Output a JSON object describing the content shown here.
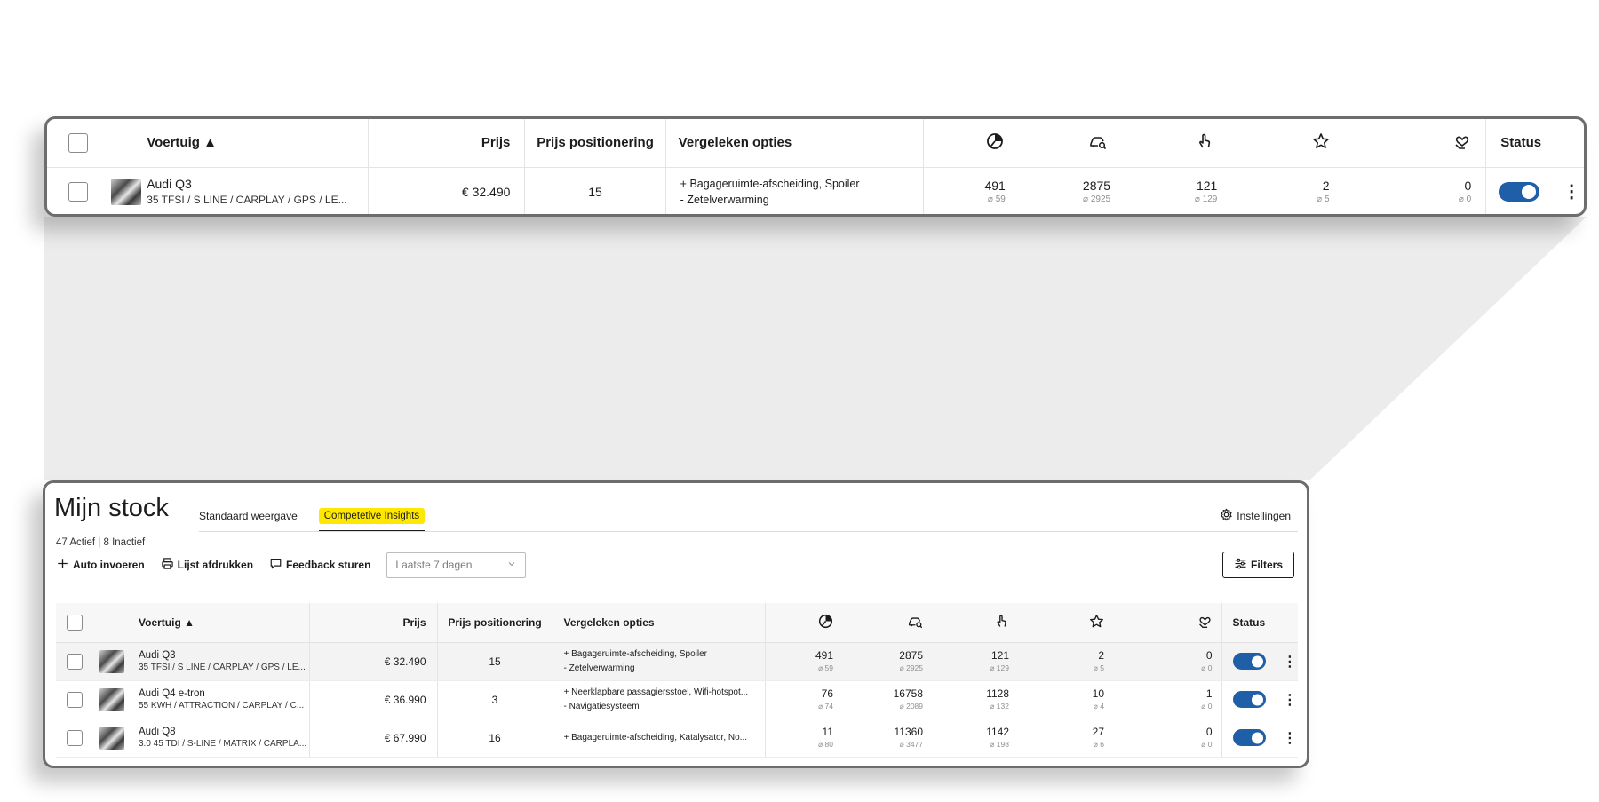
{
  "colors": {
    "accent": "#1f5fa8",
    "highlight": "#ffe800",
    "frame": "#6d6d6d"
  },
  "zoom": {
    "columns": {
      "vehicle": "Voertuig ▲",
      "price": "Prijs",
      "positioning": "Prijs positionering",
      "options": "Vergeleken opties",
      "status": "Status"
    },
    "icons": [
      "pie-chart-icon",
      "car-search-icon",
      "touch-click-icon",
      "star-icon",
      "heart-hand-icon"
    ],
    "row": {
      "name": "Audi Q3",
      "sub": "35 TFSI / S LINE / CARPLAY / GPS / LE...",
      "price": "€ 32.490",
      "positioning": "15",
      "options_plus": "+ Bagageruimte-afscheiding, Spoiler",
      "options_minus": "-  Zetelverwarming",
      "metrics": [
        {
          "value": "491",
          "avg": "⌀ 59"
        },
        {
          "value": "2875",
          "avg": "⌀ 2925"
        },
        {
          "value": "121",
          "avg": "⌀ 129"
        },
        {
          "value": "2",
          "avg": "⌀ 5"
        },
        {
          "value": "0",
          "avg": "⌀ 0"
        }
      ],
      "status_on": true
    }
  },
  "main": {
    "title": "Mijn stock",
    "tabs": {
      "standard": "Standaard weergave",
      "insights": "Competetive Insights"
    },
    "settings": "Instellingen",
    "counts": "47 Actief  |  8 Inactief",
    "toolbar": {
      "add": "Auto invoeren",
      "print": "Lijst afdrukken",
      "feedback": "Feedback sturen",
      "date": "Laatste 7 dagen",
      "filters": "Filters"
    },
    "columns": {
      "vehicle": "Voertuig ▲",
      "price": "Prijs",
      "positioning": "Prijs positionering",
      "options": "Vergeleken opties",
      "status": "Status"
    },
    "rows": [
      {
        "name": "Audi Q3",
        "sub": "35 TFSI / S LINE / CARPLAY / GPS / LE...",
        "price": "€ 32.490",
        "positioning": "15",
        "options_plus": "+ Bagageruimte-afscheiding, Spoiler",
        "options_minus": "-  Zetelverwarming",
        "metrics": [
          {
            "value": "491",
            "avg": "⌀ 59"
          },
          {
            "value": "2875",
            "avg": "⌀ 2925"
          },
          {
            "value": "121",
            "avg": "⌀ 129"
          },
          {
            "value": "2",
            "avg": "⌀ 5"
          },
          {
            "value": "0",
            "avg": "⌀ 0"
          }
        ]
      },
      {
        "name": "Audi Q4 e-tron",
        "sub": "55 KWH / ATTRACTION / CARPLAY / C...",
        "price": "€ 36.990",
        "positioning": "3",
        "options_plus": "+ Neerklapbare passagiersstoel, Wifi-hotspot...",
        "options_minus": "-  Navigatiesysteem",
        "metrics": [
          {
            "value": "76",
            "avg": "⌀ 74"
          },
          {
            "value": "16758",
            "avg": "⌀ 2089"
          },
          {
            "value": "1128",
            "avg": "⌀ 132"
          },
          {
            "value": "10",
            "avg": "⌀ 4"
          },
          {
            "value": "1",
            "avg": "⌀ 0"
          }
        ]
      },
      {
        "name": "Audi Q8",
        "sub": "3.0 45 TDI / S-LINE / MATRIX / CARPLA...",
        "price": "€ 67.990",
        "positioning": "16",
        "options_plus": "+ Bagageruimte-afscheiding, Katalysator, No...",
        "options_minus": "",
        "metrics": [
          {
            "value": "11",
            "avg": "⌀ 80"
          },
          {
            "value": "11360",
            "avg": "⌀ 3477"
          },
          {
            "value": "1142",
            "avg": "⌀ 198"
          },
          {
            "value": "27",
            "avg": "⌀ 6"
          },
          {
            "value": "0",
            "avg": "⌀ 0"
          }
        ]
      }
    ]
  }
}
